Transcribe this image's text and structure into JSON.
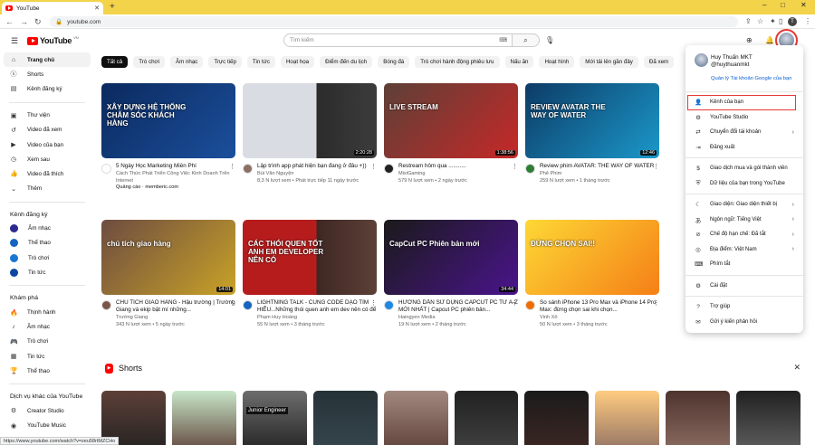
{
  "browser": {
    "tab_title": "YouTube",
    "url": "youtube.com",
    "close": "✕",
    "new_tab": "+",
    "status_url": "https://www.youtube.com/watch?v=zeu58rtMZCHo"
  },
  "header": {
    "logo_text": "YouTube",
    "logo_region": "VN",
    "search_placeholder": "Tìm kiếm"
  },
  "sidebar": {
    "main": [
      {
        "label": "Trang chủ",
        "icon": "home-icon"
      },
      {
        "label": "Shorts",
        "icon": "shorts-icon"
      },
      {
        "label": "Kênh đăng ký",
        "icon": "subscriptions-icon"
      }
    ],
    "you": [
      {
        "label": "Thư viện",
        "icon": "library-icon"
      },
      {
        "label": "Video đã xem",
        "icon": "history-icon"
      },
      {
        "label": "Video của bạn",
        "icon": "your-videos-icon"
      },
      {
        "label": "Xem sau",
        "icon": "watch-later-icon"
      },
      {
        "label": "Video đã thích",
        "icon": "liked-icon"
      },
      {
        "label": "Thêm",
        "icon": "chevron-down-icon"
      }
    ],
    "subscriptions_title": "Kênh đăng ký",
    "subscriptions": [
      {
        "label": "Âm nhạc",
        "color": "#2b2b8f"
      },
      {
        "label": "Thể thao",
        "color": "#1565c0"
      },
      {
        "label": "Trò chơi",
        "color": "#1976d2"
      },
      {
        "label": "Tin tức",
        "color": "#0d47a1"
      }
    ],
    "explore_title": "Khám phá",
    "explore": [
      {
        "label": "Thịnh hành",
        "icon": "trending-icon"
      },
      {
        "label": "Âm nhạc",
        "icon": "music-icon"
      },
      {
        "label": "Trò chơi",
        "icon": "gaming-icon"
      },
      {
        "label": "Tin tức",
        "icon": "news-icon"
      },
      {
        "label": "Thể thao",
        "icon": "sports-icon"
      }
    ],
    "more_title": "Dịch vụ khác của YouTube",
    "more": [
      {
        "label": "Creator Studio",
        "icon": "studio-icon"
      },
      {
        "label": "YouTube Music",
        "icon": "yt-music-icon"
      }
    ]
  },
  "chips": [
    "Tất cả",
    "Trò chơi",
    "Âm nhạc",
    "Trực tiếp",
    "Tin tức",
    "Hoạt họa",
    "Điểm đến du lịch",
    "Bóng đá",
    "Trò chơi hành động phiêu lưu",
    "Nấu ăn",
    "Hoạt hình",
    "Mới tải lên gần đây",
    "Đã xem",
    "Đề xuất mới"
  ],
  "videos": [
    {
      "title": "5 Ngày Học Marketing Miễn Phí",
      "sub1": "Cách Thức Phát Triển Công Việc Kinh Doanh Trên Internet",
      "sub2": "",
      "ad": "Quảng cáo · memberic.com",
      "duration": "",
      "thumb_text": "XÂY DỰNG HỆ THỐNG CHĂM SÓC KHÁCH HÀNG",
      "bg": "linear-gradient(135deg,#0b2a5e,#1b4f9c)",
      "av": "#fff"
    },
    {
      "title": "Lập trình app phát hiện bạn đang ở đâu +))",
      "sub1": "Bùi Văn Nguyện",
      "sub2": "8,3 N lượt xem • Phát trực tiếp 11 ngày trước",
      "ad": "",
      "duration": "2:20:28",
      "thumb_text": "",
      "bg": "linear-gradient(90deg,#d9dde3 0%,#d9dde3 55%,#2b2b2b 55%,#3c3c3c 100%)",
      "av": "#8d6e63"
    },
    {
      "title": "Restream hôm qua ...........",
      "sub1": "MixiGaming",
      "sub2": "579 N lượt xem • 2 ngày trước",
      "ad": "",
      "duration": "1:38:56",
      "thumb_text": "LIVE STREAM",
      "bg": "linear-gradient(135deg,#5d4037,#c62828)",
      "av": "#212121"
    },
    {
      "title": "Review phim AVATAR: THE WAY OF WATER",
      "sub1": "Phê Phim",
      "sub2": "259 N lượt xem • 1 tháng trước",
      "ad": "",
      "duration": "12:46",
      "thumb_text": "REVIEW AVATAR THE WAY OF WATER",
      "bg": "linear-gradient(135deg,#0d3b66,#1b98c9)",
      "av": "#2e7d32"
    },
    {
      "title": "CHÚ TÍCH GIAO HÀNG - Hậu trường | Trường Giang và ekip bật mí những...",
      "sub1": "Trường Giang",
      "sub2": "343 N lượt xem • 5 ngày trước",
      "ad": "",
      "duration": "14:01",
      "thumb_text": "chú tích giao hàng",
      "bg": "linear-gradient(135deg,#6d4c41,#c9a227)",
      "av": "#795548"
    },
    {
      "title": "LIGHTNING TALK - CÙNG CODE DẠO TÌM HIỂU...Những thói quen anh em dev nên có để trở thành Lập Trình Viên xịn",
      "sub1": "Phạm Huy Hoàng",
      "sub2": "55 N lượt xem • 3 tháng trước",
      "ad": "",
      "duration": "",
      "thumb_text": "CÁC THÓI QUEN TỐT ANH EM DEVELOPER NÊN CÓ",
      "bg": "linear-gradient(90deg,#b71c1c 0%,#b71c1c 55%,#3e2723 55%,#5d4037 100%)",
      "av": "#1565c0"
    },
    {
      "title": "HƯỚNG DẪN SỬ DỤNG CAPCUT PC TỪ A-Z MỚI NHẤT | Capcut PC phiên bản...",
      "sub1": "Haingyen Media",
      "sub2": "19 N lượt xem • 2 tháng trước",
      "ad": "",
      "duration": "34:44",
      "thumb_text": "CapCut PC Phiên bản mới",
      "bg": "linear-gradient(135deg,#1a1a1a,#4a148c)",
      "av": "#1e88e5"
    },
    {
      "title": "So sánh iPhone 13 Pro Max và iPhone 14 Pro Max: đừng chọn sai khi chọn...",
      "sub1": "Vinh Xô",
      "sub2": "50 N lượt xem • 3 tháng trước",
      "ad": "",
      "duration": "",
      "thumb_text": "ĐỪNG CHỌN SAI!!",
      "bg": "linear-gradient(135deg,#fdd835,#f57f17)",
      "av": "#ef6c00"
    }
  ],
  "shorts": {
    "title": "Shorts",
    "items": [
      {
        "label": "",
        "bg": "linear-gradient(#5d4037,#212121)"
      },
      {
        "label": "",
        "bg": "linear-gradient(#c8e6c9,#5d4037)"
      },
      {
        "label": "Junior Engineer",
        "bg": "linear-gradient(#6d6d6d,#212121)"
      },
      {
        "label": "",
        "bg": "linear-gradient(#263238,#37474f)"
      },
      {
        "label": "",
        "bg": "linear-gradient(#a1887f,#5d4037)"
      },
      {
        "label": "",
        "bg": "linear-gradient(#212121,#424242)"
      },
      {
        "label": "",
        "bg": "linear-gradient(#1b1b1b,#3e2723)"
      },
      {
        "label": "",
        "bg": "linear-gradient(#ffcc80,#8d6e63)"
      },
      {
        "label": "",
        "bg": "linear-gradient(#4e342e,#8d6e63)"
      },
      {
        "label": "",
        "bg": "linear-gradient(#212121,#616161)"
      }
    ]
  },
  "account_menu": {
    "name": "Huy Thuấn MKT",
    "handle": "@huythuanmkt",
    "manage_link": "Quản lý Tài khoản Google của bạn",
    "items": [
      {
        "label": "Kênh của bạn",
        "icon": "user-icon",
        "chev": false,
        "sep": false
      },
      {
        "label": "YouTube Studio",
        "icon": "studio-icon",
        "chev": false,
        "sep": false
      },
      {
        "label": "Chuyển đổi tài khoản",
        "icon": "switch-account-icon",
        "chev": true,
        "sep": false
      },
      {
        "label": "Đăng xuất",
        "icon": "sign-out-icon",
        "chev": false,
        "sep": true
      },
      {
        "label": "Giao dịch mua và gói thành viên",
        "icon": "dollar-icon",
        "chev": false,
        "sep": false
      },
      {
        "label": "Dữ liệu của bạn trong YouTube",
        "icon": "shield-icon",
        "chev": false,
        "sep": true
      },
      {
        "label": "Giao diện: Giao diện thiết bị",
        "icon": "moon-icon",
        "chev": true,
        "sep": false
      },
      {
        "label": "Ngôn ngữ: Tiếng Việt",
        "icon": "translate-icon",
        "chev": true,
        "sep": false
      },
      {
        "label": "Chế độ hạn chế: Đã tắt",
        "icon": "restricted-icon",
        "chev": true,
        "sep": false
      },
      {
        "label": "Địa điểm: Việt Nam",
        "icon": "globe-icon",
        "chev": true,
        "sep": false
      },
      {
        "label": "Phím tắt",
        "icon": "keyboard-icon",
        "chev": false,
        "sep": true
      },
      {
        "label": "Cài đặt",
        "icon": "gear-icon",
        "chev": false,
        "sep": true
      },
      {
        "label": "Trợ giúp",
        "icon": "help-icon",
        "chev": false,
        "sep": false
      },
      {
        "label": "Gửi ý kiến phản hồi",
        "icon": "feedback-icon",
        "chev": false,
        "sep": false
      }
    ]
  },
  "colors": {
    "accent": "#ff0000",
    "highlight": "#e53935",
    "browser_bar": "#f3d34a"
  }
}
